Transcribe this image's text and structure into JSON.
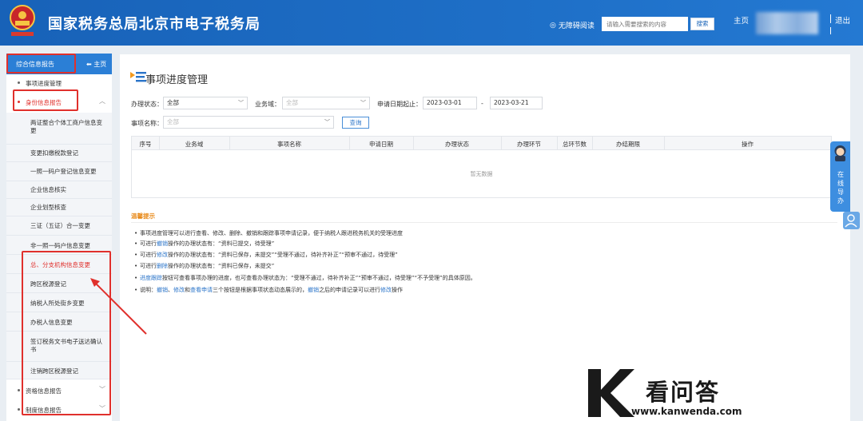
{
  "header": {
    "site_title": "国家税务总局北京市电子税务局",
    "accessibility": "无障碍阅读",
    "search_placeholder": "请输入需要搜索的内容",
    "search_button": "搜索",
    "home_link": "主页",
    "logout": "退出",
    "brand_color": "#1e6fc7"
  },
  "sidebar": {
    "header_title": "综合信息报告",
    "home_label": "主页",
    "items": [
      {
        "label": "事项进度管理"
      },
      {
        "label": "身份信息报告",
        "expanded": true,
        "active": true
      }
    ],
    "sub_items": [
      {
        "label": "两证整合个体工商户信息变更"
      },
      {
        "label": "变更扣缴税款登记"
      },
      {
        "label": "一照一码户登记信息变更"
      },
      {
        "label": "企业信息核实"
      },
      {
        "label": "企业划型核查"
      },
      {
        "label": "三证（五证）合一变更"
      },
      {
        "label": "非一照一码户信息变更"
      },
      {
        "label": "总、分支机构信息变更",
        "active": true
      },
      {
        "label": "跨区税源登记"
      },
      {
        "label": "纳税人所处街乡变更"
      },
      {
        "label": "办税人信息变更"
      },
      {
        "label": "签订税务文书电子送达确认书"
      },
      {
        "label": "注销跨区税源登记"
      }
    ],
    "bottom_items": [
      {
        "label": "资格信息报告"
      },
      {
        "label": "制度信息报告"
      }
    ]
  },
  "main": {
    "title": "事项进度管理",
    "filters": {
      "status_label": "办理状态：",
      "status_value": "全部",
      "domain_label": "业务域：",
      "domain_placeholder": "全部",
      "date_label": "申请日期起止：",
      "date_from": "2023-03-01",
      "date_sep": "-",
      "date_to": "2023-03-21",
      "item_label": "事项名称：",
      "item_placeholder": "全部",
      "query_button": "查询"
    },
    "table": {
      "columns": [
        "序号",
        "业务域",
        "事项名称",
        "申请日期",
        "办理状态",
        "办理环节",
        "总环节数",
        "办结期限",
        "操作"
      ],
      "empty_text": "暂无数据"
    },
    "tips": {
      "title": "温馨提示",
      "lines": [
        [
          "事项进度管理可以进行查看、修改、删除、撤销和跟踪事项申请记录，便于纳税人跟进税务机关的受理进度"
        ],
        [
          "可进行",
          "撤销",
          "操作的办理状态有：“资料已提交，待受理”"
        ],
        [
          "可进行",
          "修改",
          "操作的办理状态有：“资料已保存，未提交”“受理不通过，待补齐补正”“预审不通过，待受理”"
        ],
        [
          "可进行",
          "删除",
          "操作的办理状态有：“资料已保存，未提交”"
        ],
        [
          "",
          "进度跟踪",
          "按钮可查看事项办理的进度，也可查看办理状态为：“受理不通过，待补齐补正”“预审不通过，待受理”“不予受理”的具体原因。"
        ],
        [
          "说明：",
          "撤销",
          "、",
          "修改",
          "和",
          "查看申请",
          "三个按钮是根据事项状态动态展示的，",
          "撤销",
          "之后的申请记录可以进行",
          "修改",
          "操作"
        ]
      ]
    }
  },
  "float": {
    "guide_label": "在线导办"
  },
  "watermark": {
    "cn": "看问答",
    "url": "www.kanwenda.com"
  }
}
